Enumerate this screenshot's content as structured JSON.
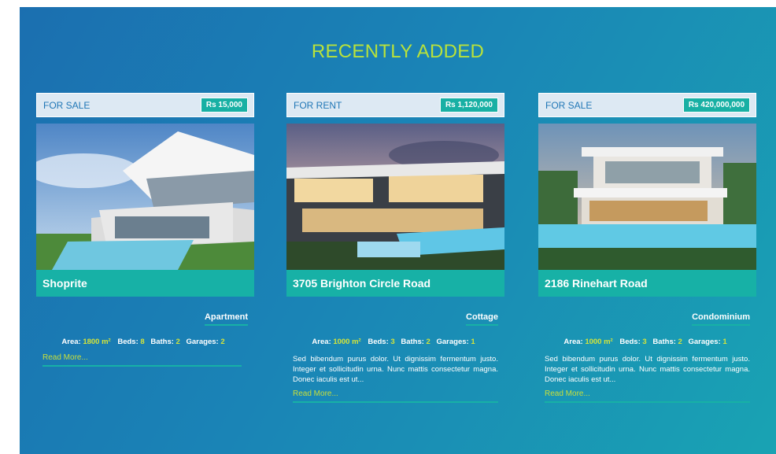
{
  "section": {
    "title": "RECENTLY ADDED"
  },
  "listings": [
    {
      "status": "FOR SALE",
      "price": "Rs 15,000",
      "name": "Shoprite",
      "property_type": "Apartment",
      "area_label": "Area:",
      "area_value": "1800 m²",
      "beds_label": "Beds:",
      "beds_value": "8",
      "baths_label": "Baths:",
      "baths_value": "2",
      "garages_label": "Garages:",
      "garages_value": "2",
      "description": "",
      "read_more": "Read More..."
    },
    {
      "status": "FOR RENT",
      "price": "Rs 1,120,000",
      "name": "3705 Brighton Circle Road",
      "property_type": "Cottage",
      "area_label": "Area:",
      "area_value": "1000 m²",
      "beds_label": "Beds:",
      "beds_value": "3",
      "baths_label": "Baths:",
      "baths_value": "2",
      "garages_label": "Garages:",
      "garages_value": "1",
      "description": "Sed bibendum purus dolor. Ut dignissim fermentum justo. Integer et sollicitudin urna. Nunc mattis consectetur magna. Donec iaculis est ut...",
      "read_more": "Read More..."
    },
    {
      "status": "FOR SALE",
      "price": "Rs 420,000,000",
      "name": "2186 Rinehart Road",
      "property_type": "Condominium",
      "area_label": "Area:",
      "area_value": "1000 m²",
      "beds_label": "Beds:",
      "beds_value": "3",
      "baths_label": "Baths:",
      "baths_value": "2",
      "garages_label": "Garages:",
      "garages_value": "1",
      "description": "Sed bibendum purus dolor. Ut dignissim fermentum justo. Integer et sollicitudin urna. Nunc mattis consectetur magna. Donec iaculis est ut...",
      "read_more": "Read More..."
    }
  ],
  "colors": {
    "accent_teal": "#17b1a6",
    "title_green": "#b9e23a",
    "status_text_blue": "#1f76b6",
    "value_yellow": "#d4e43a"
  }
}
